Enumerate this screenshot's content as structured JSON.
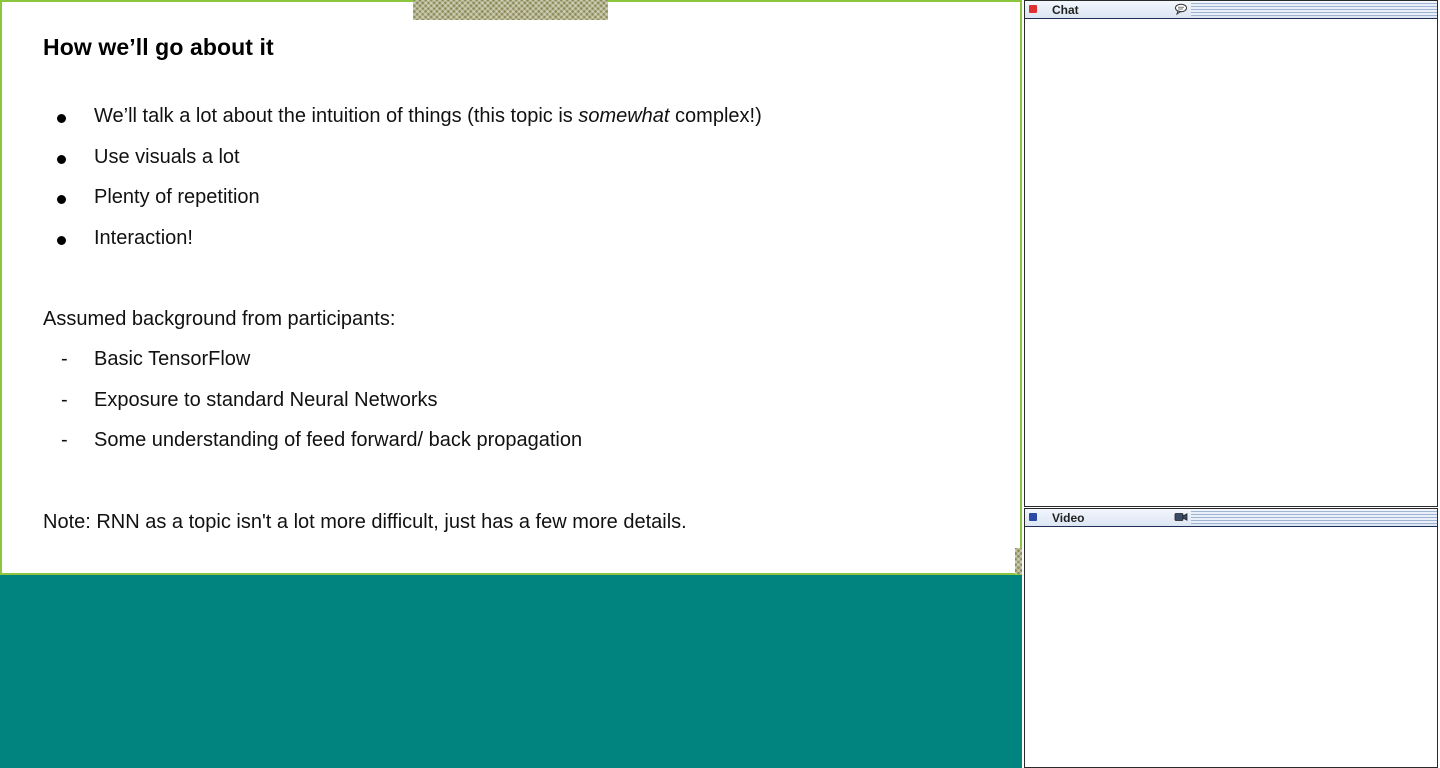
{
  "slide": {
    "title": "How we’ll go about it",
    "bullets": [
      {
        "before": "We’ll talk a lot about the intuition of things (this topic is ",
        "em": "somewhat",
        "after": " complex!)"
      },
      {
        "text": "Use visuals a lot"
      },
      {
        "text": "Plenty of repetition"
      },
      {
        "text": "Interaction!"
      }
    ],
    "background_heading": "Assumed background from participants:",
    "background_dash": "-",
    "background_items": [
      "Basic TensorFlow",
      "Exposure to standard Neural Networks",
      "Some understanding of feed forward/ back propagation"
    ],
    "note": "Note:  RNN as a topic isn't a lot more difficult, just has a few more details."
  },
  "panels": {
    "chat": {
      "title": "Chat",
      "status_color": "#e03030",
      "icon": "chat-bubble-icon"
    },
    "video": {
      "title": "Video",
      "status_color": "#2b4aa8",
      "icon": "video-camera-icon"
    }
  },
  "colors": {
    "stage_background": "#01837f",
    "slide_border": "#8cc63f"
  }
}
